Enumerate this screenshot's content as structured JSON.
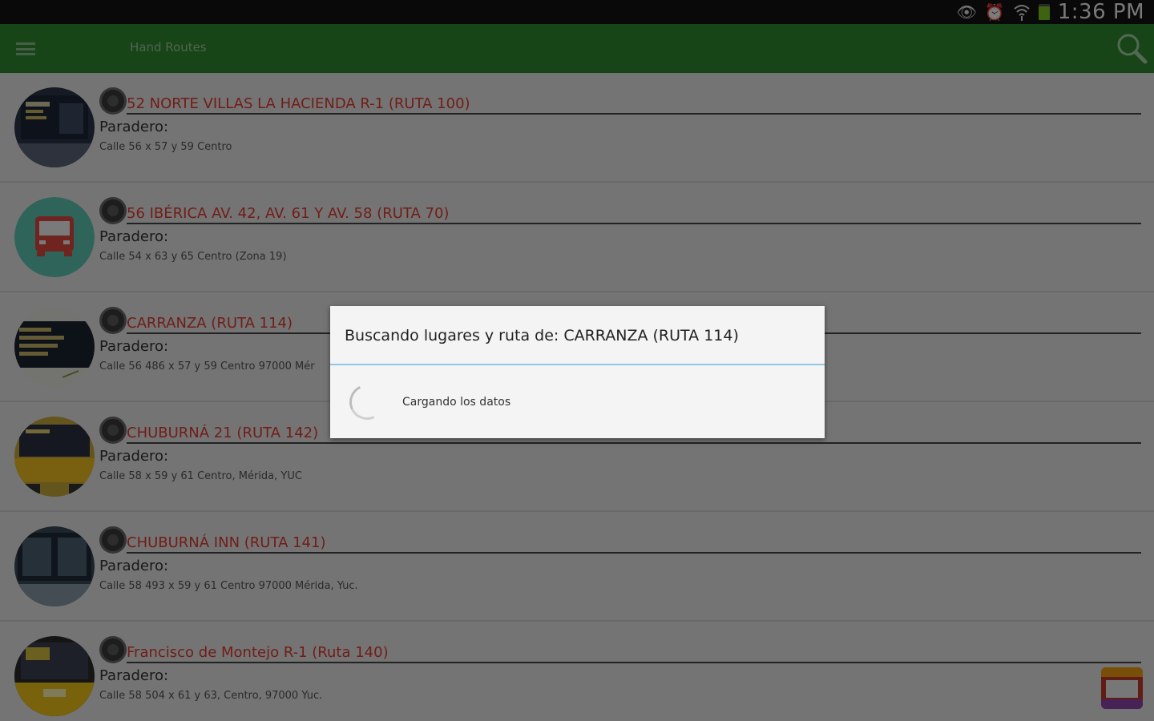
{
  "status_bar": {
    "time": "1:36 PM",
    "icons": [
      "eye-icon",
      "alarm-icon",
      "wifi-icon",
      "battery-icon"
    ]
  },
  "action_bar": {
    "title": "Hand Routes",
    "color": "#2e8a30",
    "icons": [
      "menu-icon",
      "search-icon"
    ]
  },
  "routes": [
    {
      "title": "52 NORTE VILLAS LA HACIENDA R-1 (RUTA 100)",
      "stop_label": "Paradero:",
      "address": "Calle 56 x 57 y 59 Centro",
      "thumb": "bus-photo"
    },
    {
      "title": "56 IBÉRICA AV. 42, AV. 61 Y AV. 58 (RUTA 70)",
      "stop_label": "Paradero:",
      "address": "Calle 54 x 63 y 65 Centro (Zona 19)",
      "thumb": "bus-icon"
    },
    {
      "title": "CARRANZA (RUTA 114)",
      "stop_label": "Paradero:",
      "address": "Calle 56 486 x 57 y 59 Centro 97000 Mér",
      "thumb": "bus-photo"
    },
    {
      "title": "CHUBURNÁ 21 (RUTA 142)",
      "stop_label": "Paradero:",
      "address": "Calle 58 x 59 y 61 Centro, Mérida, YUC",
      "thumb": "bus-photo"
    },
    {
      "title": "CHUBURNÁ INN (RUTA 141)",
      "stop_label": "Paradero:",
      "address": "Calle 58 493 x 59 y 61 Centro 97000 Mérida, Yuc.",
      "thumb": "bus-photo"
    },
    {
      "title": "Francisco de Montejo R-1 (Ruta 140)",
      "stop_label": "Paradero:",
      "address": "Calle 58 504 x 61 y 63, Centro, 97000 Yuc.",
      "thumb": "bus-photo"
    }
  ],
  "dialog": {
    "title": "Buscando lugares y ruta de: CARRANZA (RUTA 114)",
    "message": "Cargando los datos",
    "divider_color": "#8fc7e6"
  },
  "colors": {
    "route_title": "#e23a2e",
    "accent_teal": "#5ec8b4"
  }
}
